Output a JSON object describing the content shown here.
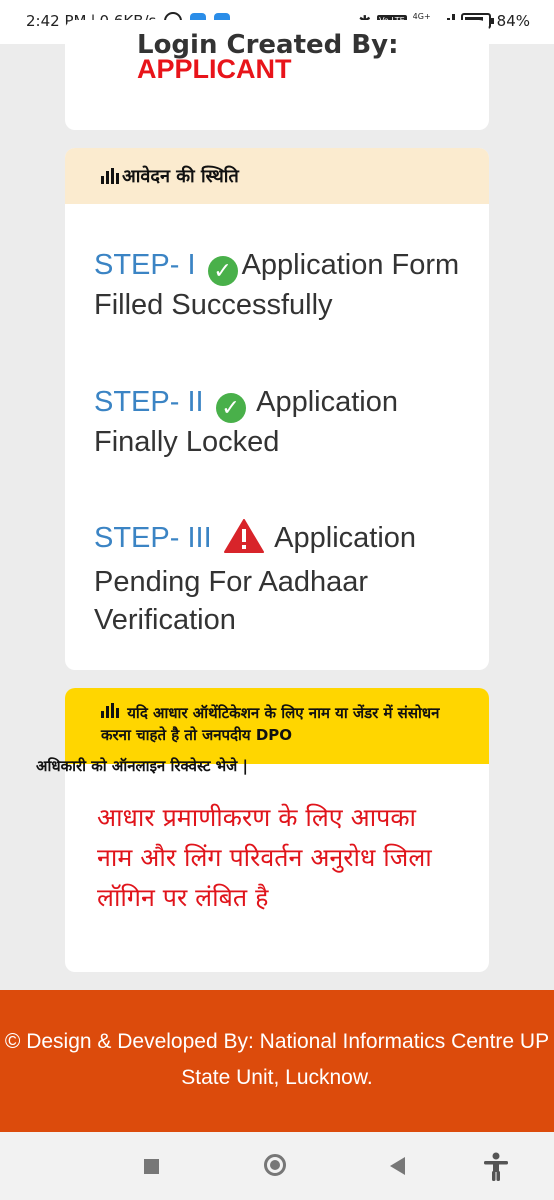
{
  "status_bar": {
    "time": "2:42 PM",
    "speed": "0.6KB/s",
    "network_top": "4G+",
    "network_bottom": "4R",
    "volte": "Vo LTE",
    "battery": "84%"
  },
  "login": {
    "created_by_label": "Login Created By:",
    "created_by_value": "APPLICANT"
  },
  "status_card": {
    "title": "आवेदन की स्थिति",
    "steps": [
      {
        "label": "STEP- I",
        "text": "Application Form Filled Successfully",
        "status_icon": "check-icon"
      },
      {
        "label": "STEP- II",
        "text": "Application Finally Locked",
        "status_icon": "check-icon"
      },
      {
        "label": "STEP- III",
        "text": "Application Pending For Aadhaar Verification",
        "status_icon": "warning-icon"
      }
    ]
  },
  "notice": {
    "text": "यदि आधार ऑथेंटिकेशन के लिए नाम या जेंडर में संसोधन करना चाहते है तो जनपदीय DPO",
    "text_overflow": "अधिकारी को ऑनलाइन रिक्वेस्ट भेजे |",
    "pending_message": "आधार प्रमाणीकरण के लिए आपका नाम और लिंग परिवर्तन अनुरोध जिला लॉगिन पर लंबित है"
  },
  "footer": {
    "text": "© Design & Developed By: National Informatics Centre UP State Unit, Lucknow."
  },
  "colors": {
    "step_label": "#3b84c4",
    "applicant": "#e8141a",
    "status_header_bg": "#fbebcf",
    "notice_bg": "#ffd600",
    "pending_text": "#e0141b",
    "footer_bg": "#dc4b0c",
    "check_green": "#49b04a",
    "warning_red": "#d8242a"
  }
}
